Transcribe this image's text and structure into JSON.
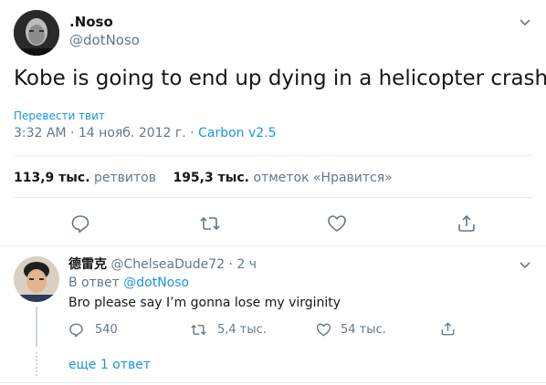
{
  "tweet": {
    "author_name": ".Noso",
    "author_handle": "@dotNoso",
    "text": "Kobe is going to end up dying in a helicopter crash",
    "translate_label": "Перевести твит",
    "timestamp": "3:32 AM · 14 нояб. 2012 г.",
    "separator": " · ",
    "source": "Carbon v2.5",
    "retweets_count": "113,9 тыс.",
    "retweets_label": "ретвитов",
    "likes_count": "195,3 тыс.",
    "likes_label": "отметок «Нравится»"
  },
  "reply": {
    "author_name": "德雷克",
    "author_handle": "@ChelseaDude72",
    "time_ago": " · 2 ч",
    "reply_to_prefix": "В ответ",
    "reply_to_handle": "@dotNoso",
    "text": "Bro please say I’m gonna lose my virginity",
    "reply_count": "540",
    "retweet_count": "5,4 тыс.",
    "like_count": "54 тыс."
  },
  "more_replies_label": "еще 1 ответ",
  "colors": {
    "accent": "#1b95e0",
    "muted": "#657786",
    "divider": "#e6ecf0"
  }
}
